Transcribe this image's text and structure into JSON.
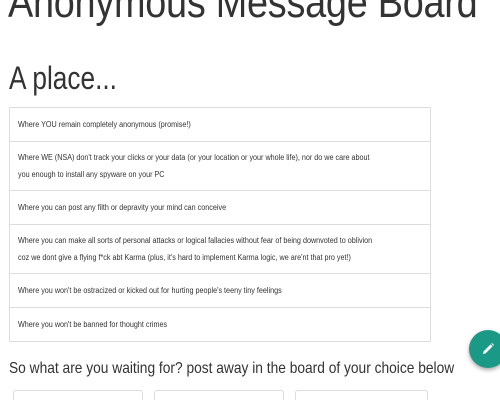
{
  "header": {
    "title": "Anonymous Message Board",
    "subtitle": "A place..."
  },
  "features": [
    "Where YOU remain completely anonymous (promise!)",
    "Where WE (NSA) don't track your clicks or your data (or your location or your whole life), nor do we care about you enough to install any spyware on your PC",
    "Where you can post any filth or depravity your mind can conceive",
    "Where you can make all sorts of personal attacks or logical fallacies without fear of being downvoted to oblivion coz we dont give a flying f*ck abt Karma (plus, it's hard to implement Karma logic, we are'nt that pro yet!)",
    "Where you won't be ostracized or kicked out for hurting people's teeny tiny feelings",
    "Where you won't be banned for thought crimes"
  ],
  "cta": {
    "text": "So what are you waiting for? post away in the board of your choice below"
  },
  "fab": {
    "icon": "pencil-icon",
    "color": "#1a9a86"
  },
  "colors": {
    "text": "#333333",
    "border": "#dddddd",
    "accent": "#1a9a86"
  }
}
